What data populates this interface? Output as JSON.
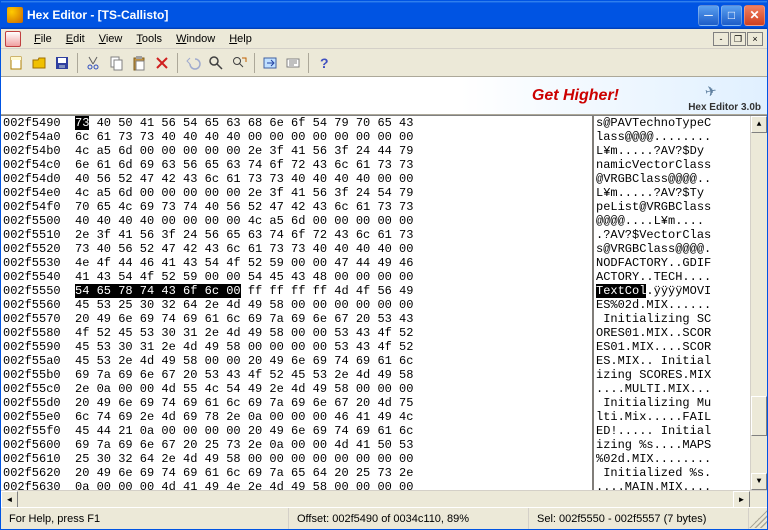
{
  "titlebar": {
    "title": "Hex Editor - [TS-Callisto]"
  },
  "menu": {
    "items": [
      "File",
      "Edit",
      "View",
      "Tools",
      "Window",
      "Help"
    ]
  },
  "banner": {
    "slogan": "Get Higher!",
    "version": "Hex Editor 3.0b"
  },
  "status": {
    "help": "For Help, press F1",
    "offset": "Offset: 002f5490 of 0034c110, 89%",
    "sel": "Sel: 002f5550 - 002f5557 (7 bytes)"
  },
  "rows": [
    {
      "off": "002f5490",
      "hex": "73 40 50 41 56 54 65 63 68 6e 6f 54 79 70 65 43",
      "asc": "s@PAVTechnoTypeC"
    },
    {
      "off": "002f54a0",
      "hex": "6c 61 73 73 40 40 40 40 00 00 00 00 00 00 00 00",
      "asc": "lass@@@@........"
    },
    {
      "off": "002f54b0",
      "hex": "4c a5 6d 00 00 00 00 00 2e 3f 41 56 3f 24 44 79",
      "asc": "L¥m.....?AV?$Dy"
    },
    {
      "off": "002f54c0",
      "hex": "6e 61 6d 69 63 56 65 63 74 6f 72 43 6c 61 73 73",
      "asc": "namicVectorClass"
    },
    {
      "off": "002f54d0",
      "hex": "40 56 52 47 42 43 6c 61 73 73 40 40 40 40 00 00",
      "asc": "@VRGBClass@@@@.."
    },
    {
      "off": "002f54e0",
      "hex": "4c a5 6d 00 00 00 00 00 2e 3f 41 56 3f 24 54 79",
      "asc": "L¥m.....?AV?$Ty"
    },
    {
      "off": "002f54f0",
      "hex": "70 65 4c 69 73 74 40 56 52 47 42 43 6c 61 73 73",
      "asc": "peList@VRGBClass"
    },
    {
      "off": "002f5500",
      "hex": "40 40 40 40 00 00 00 00 4c a5 6d 00 00 00 00 00",
      "asc": "@@@@....L¥m...."
    },
    {
      "off": "002f5510",
      "hex": "2e 3f 41 56 3f 24 56 65 63 74 6f 72 43 6c 61 73",
      "asc": ".?AV?$VectorClas"
    },
    {
      "off": "002f5520",
      "hex": "73 40 56 52 47 42 43 6c 61 73 73 40 40 40 40 00",
      "asc": "s@VRGBClass@@@@."
    },
    {
      "off": "002f5530",
      "hex": "4e 4f 44 46 41 43 54 4f 52 59 00 00 47 44 49 46",
      "asc": "NODFACTORY..GDIF"
    },
    {
      "off": "002f5540",
      "hex": "41 43 54 4f 52 59 00 00 54 45 43 48 00 00 00 00",
      "asc": "ACTORY..TECH...."
    },
    {
      "off": "002f5550",
      "hex": "54 65 78 74 43 6f 6c 00 ff ff ff ff 4d 4f 56 49",
      "asc": "TextCol.ÿÿÿÿMOVI",
      "selHex": [
        0,
        7
      ],
      "selAsc": [
        0,
        7
      ]
    },
    {
      "off": "002f5560",
      "hex": "45 53 25 30 32 64 2e 4d 49 58 00 00 00 00 00 00",
      "asc": "ES%02d.MIX......"
    },
    {
      "off": "002f5570",
      "hex": "20 49 6e 69 74 69 61 6c 69 7a 69 6e 67 20 53 43",
      "asc": " Initializing SC"
    },
    {
      "off": "002f5580",
      "hex": "4f 52 45 53 30 31 2e 4d 49 58 00 00 53 43 4f 52",
      "asc": "ORES01.MIX..SCOR"
    },
    {
      "off": "002f5590",
      "hex": "45 53 30 31 2e 4d 49 58 00 00 00 00 53 43 4f 52",
      "asc": "ES01.MIX....SCOR"
    },
    {
      "off": "002f55a0",
      "hex": "45 53 2e 4d 49 58 00 00 20 49 6e 69 74 69 61 6c",
      "asc": "ES.MIX.. Initial"
    },
    {
      "off": "002f55b0",
      "hex": "69 7a 69 6e 67 20 53 43 4f 52 45 53 2e 4d 49 58",
      "asc": "izing SCORES.MIX"
    },
    {
      "off": "002f55c0",
      "hex": "2e 0a 00 00 4d 55 4c 54 49 2e 4d 49 58 00 00 00",
      "asc": "....MULTI.MIX..."
    },
    {
      "off": "002f55d0",
      "hex": "20 49 6e 69 74 69 61 6c 69 7a 69 6e 67 20 4d 75",
      "asc": " Initializing Mu"
    },
    {
      "off": "002f55e0",
      "hex": "6c 74 69 2e 4d 69 78 2e 0a 00 00 00 46 41 49 4c",
      "asc": "lti.Mix.....FAIL"
    },
    {
      "off": "002f55f0",
      "hex": "45 44 21 0a 00 00 00 00 20 49 6e 69 74 69 61 6c",
      "asc": "ED!..... Initial"
    },
    {
      "off": "002f5600",
      "hex": "69 7a 69 6e 67 20 25 73 2e 0a 00 00 4d 41 50 53",
      "asc": "izing %s....MAPS"
    },
    {
      "off": "002f5610",
      "hex": "25 30 32 64 2e 4d 49 58 00 00 00 00 00 00 00 00",
      "asc": "%02d.MIX........"
    },
    {
      "off": "002f5620",
      "hex": "20 49 6e 69 74 69 61 6c 69 7a 65 64 20 25 73 2e",
      "asc": " Initialized %s."
    },
    {
      "off": "002f5630",
      "hex": "0a 00 00 00 4d 41 49 4e 2e 4d 49 58 00 00 00 00",
      "asc": "....MAIN.MIX...."
    }
  ]
}
